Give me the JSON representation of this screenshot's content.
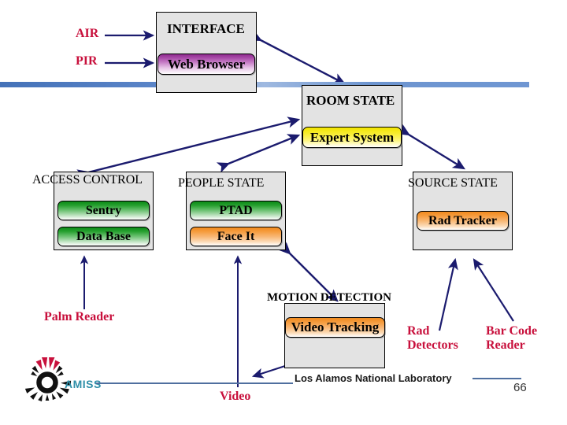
{
  "slide": {
    "page_number": "66",
    "footer": "Los Alamos National Laboratory",
    "logo_text": "AMISS"
  },
  "colors": {
    "box_fill": "#e3e3e3",
    "box_border": "#000000",
    "arrow": "#1b1b6e",
    "red_label": "#c8103c",
    "bar_blue": "#5b85c8",
    "green_button": "#0b8a16",
    "orange_button": "#f08a1e",
    "yellow_button": "#f2e400",
    "purple_button": "#8e2a8e",
    "logo_teal": "#2f8fa8",
    "logo_red": "#c8103c"
  },
  "groups": [
    {
      "id": "interface",
      "caption": "INTERFACE"
    },
    {
      "id": "room_state",
      "caption": "ROOM STATE"
    },
    {
      "id": "access_control",
      "caption": "ACCESS CONTROL"
    },
    {
      "id": "people_state",
      "caption": "PEOPLE STATE"
    },
    {
      "id": "source_state",
      "caption": "SOURCE STATE"
    },
    {
      "id": "motion_detection",
      "caption": "MOTION DETECTION"
    }
  ],
  "buttons": {
    "web_browser": "Web Browser",
    "expert_system": "Expert System",
    "sentry": "Sentry",
    "data_base": "Data Base",
    "ptad": "PTAD",
    "face_it": "Face It",
    "rad_tracker": "Rad Tracker",
    "video_tracking": "Video Tracking"
  },
  "sensors": {
    "air": "AIR",
    "pir": "PIR",
    "palm_reader": "Palm Reader",
    "video": "Video",
    "rad_detectors": "Rad\nDetectors",
    "rad_detectors_line1": "Rad",
    "rad_detectors_line2": "Detectors",
    "bar_code_reader_line1": "Bar Code",
    "bar_code_reader_line2": "Reader"
  }
}
